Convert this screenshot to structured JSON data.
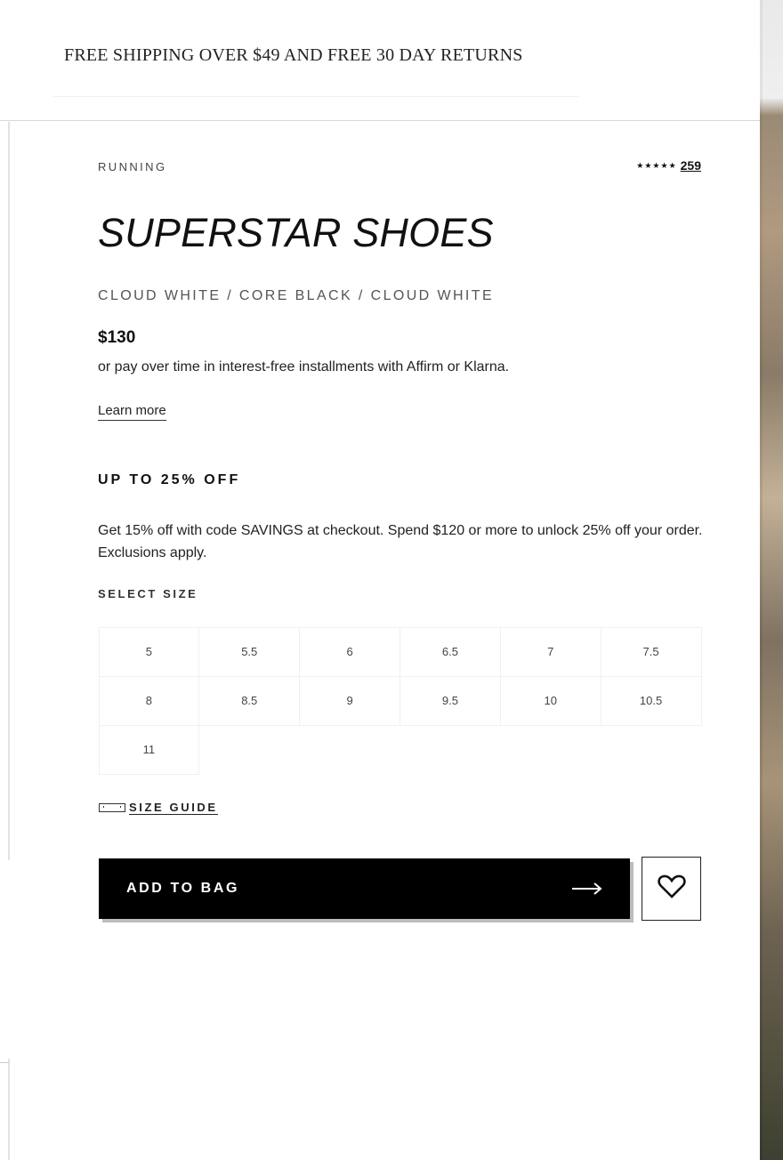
{
  "promo": {
    "text": "FREE SHIPPING OVER $49 AND FREE 30 DAY RETURNS"
  },
  "product": {
    "category": "RUNNING",
    "rating": {
      "stars": "★★★★★",
      "review_count": "259"
    },
    "title": "SUPERSTAR SHOES",
    "colorway": "CLOUD WHITE / CORE BLACK / CLOUD WHITE",
    "price": "$130",
    "installments": "or pay over time in interest-free installments with Affirm or Klarna.",
    "learn_more": "Learn more"
  },
  "offer": {
    "heading": "UP TO 25% OFF",
    "text": "Get 15% off with code SAVINGS at checkout. Spend $120 or more to unlock 25% off your order. Exclusions apply."
  },
  "sizes": {
    "label": "SELECT SIZE",
    "options": [
      "5",
      "5.5",
      "6",
      "6.5",
      "7",
      "7.5",
      "8",
      "8.5",
      "9",
      "9.5",
      "10",
      "10.5",
      "11"
    ],
    "size_guide": "SIZE GUIDE"
  },
  "actions": {
    "add_to_bag": "ADD TO BAG",
    "arrow_icon": "arrow-right-icon",
    "wishlist_icon": "heart-icon"
  },
  "colors": {
    "primary": "#000000",
    "background": "#ffffff",
    "text": "#111111"
  }
}
